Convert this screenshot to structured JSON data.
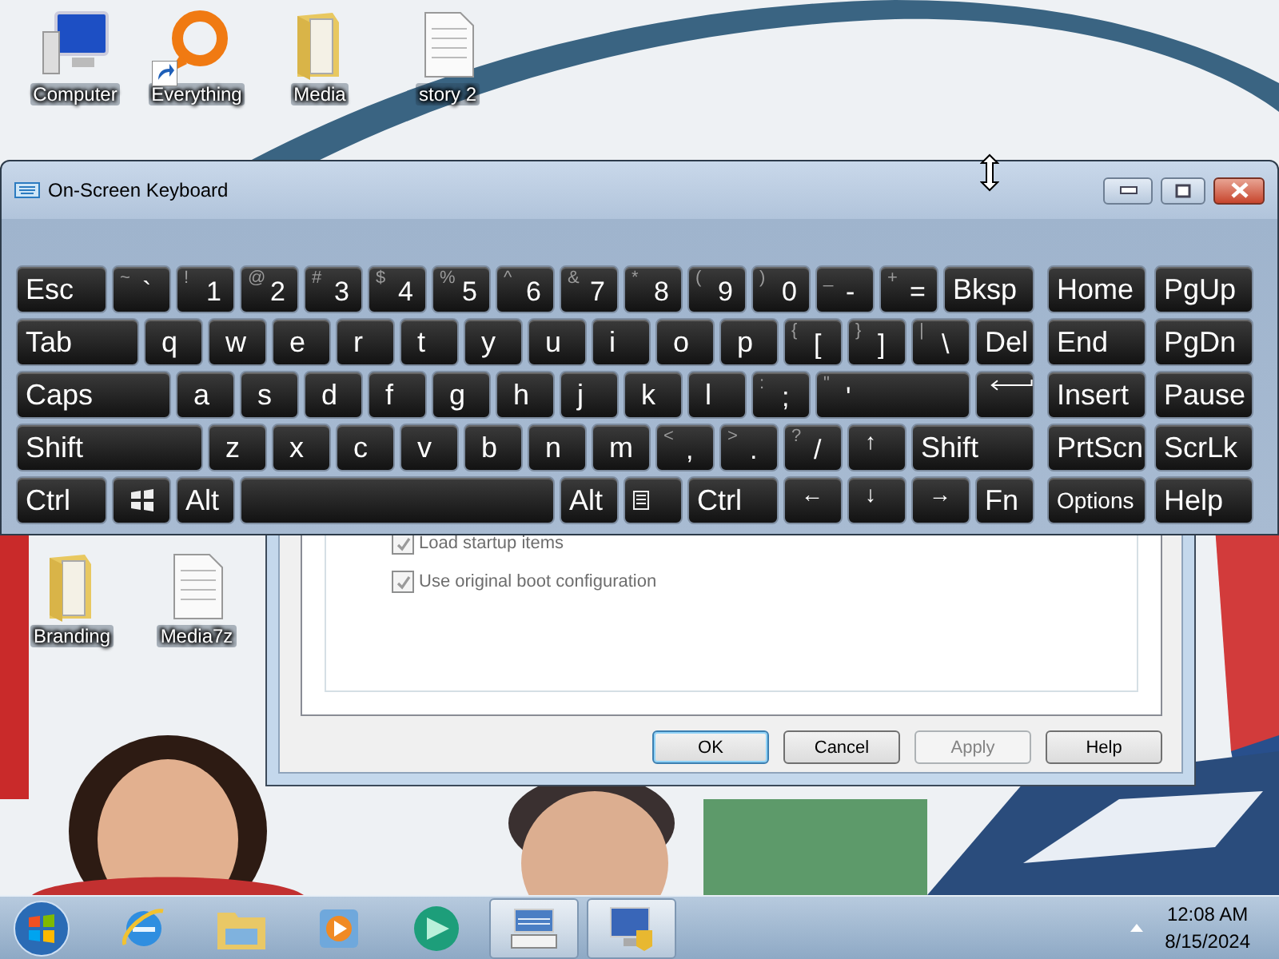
{
  "desktop_icons": [
    {
      "label": "Computer",
      "kind": "computer",
      "shortcut": false
    },
    {
      "label": "Everything",
      "kind": "everything",
      "shortcut": true
    },
    {
      "label": "Media",
      "kind": "folder",
      "shortcut": false
    },
    {
      "label": "story 2",
      "kind": "document",
      "shortcut": false
    },
    {
      "label": "Branding",
      "kind": "folder",
      "shortcut": false
    },
    {
      "label": "Media7z",
      "kind": "document",
      "shortcut": false
    }
  ],
  "background_window": {
    "checkboxes": [
      {
        "label": "Load startup items",
        "checked": true,
        "disabled": true
      },
      {
        "label": "Use original boot configuration",
        "checked": true,
        "disabled": true
      }
    ],
    "buttons": [
      {
        "label": "OK",
        "default": true,
        "disabled": false
      },
      {
        "label": "Cancel",
        "default": false,
        "disabled": false
      },
      {
        "label": "Apply",
        "default": false,
        "disabled": true
      },
      {
        "label": "Help",
        "default": false,
        "disabled": false
      }
    ]
  },
  "keyboard": {
    "title": "On-Screen Keyboard",
    "rows": [
      {
        "keys": [
          {
            "kind": "mod",
            "label": "Esc"
          },
          {
            "kind": "char",
            "label": "`",
            "shift": "~"
          },
          {
            "kind": "char",
            "label": "1",
            "shift": "!"
          },
          {
            "kind": "char",
            "label": "2",
            "shift": "@"
          },
          {
            "kind": "char",
            "label": "3",
            "shift": "#"
          },
          {
            "kind": "char",
            "label": "4",
            "shift": "$"
          },
          {
            "kind": "char",
            "label": "5",
            "shift": "%"
          },
          {
            "kind": "char",
            "label": "6",
            "shift": "^"
          },
          {
            "kind": "char",
            "label": "7",
            "shift": "&"
          },
          {
            "kind": "char",
            "label": "8",
            "shift": "*"
          },
          {
            "kind": "char",
            "label": "9",
            "shift": "("
          },
          {
            "kind": "char",
            "label": "0",
            "shift": ")"
          },
          {
            "kind": "char",
            "label": "-",
            "shift": "_"
          },
          {
            "kind": "char",
            "label": "=",
            "shift": "+"
          },
          {
            "kind": "mod",
            "label": "Bksp"
          }
        ]
      },
      {
        "keys": [
          {
            "kind": "mod",
            "label": "Tab"
          },
          {
            "kind": "char",
            "label": "q"
          },
          {
            "kind": "char",
            "label": "w"
          },
          {
            "kind": "char",
            "label": "e"
          },
          {
            "kind": "char",
            "label": "r"
          },
          {
            "kind": "char",
            "label": "t"
          },
          {
            "kind": "char",
            "label": "y"
          },
          {
            "kind": "char",
            "label": "u"
          },
          {
            "kind": "char",
            "label": "i"
          },
          {
            "kind": "char",
            "label": "o"
          },
          {
            "kind": "char",
            "label": "p"
          },
          {
            "kind": "char",
            "label": "[",
            "shift": "{"
          },
          {
            "kind": "char",
            "label": "]",
            "shift": "}"
          },
          {
            "kind": "char",
            "label": "\\",
            "shift": "|"
          },
          {
            "kind": "mod",
            "label": "Del"
          }
        ]
      },
      {
        "keys": [
          {
            "kind": "mod",
            "label": "Caps"
          },
          {
            "kind": "char",
            "label": "a"
          },
          {
            "kind": "char",
            "label": "s"
          },
          {
            "kind": "char",
            "label": "d"
          },
          {
            "kind": "char",
            "label": "f"
          },
          {
            "kind": "char",
            "label": "g"
          },
          {
            "kind": "char",
            "label": "h"
          },
          {
            "kind": "char",
            "label": "j"
          },
          {
            "kind": "char",
            "label": "k"
          },
          {
            "kind": "char",
            "label": "l"
          },
          {
            "kind": "char",
            "label": ";",
            "shift": ":"
          },
          {
            "kind": "char",
            "label": "'",
            "shift": "\""
          },
          {
            "kind": "enter"
          }
        ]
      },
      {
        "keys": [
          {
            "kind": "mod",
            "label": "Shift"
          },
          {
            "kind": "char",
            "label": "z"
          },
          {
            "kind": "char",
            "label": "x"
          },
          {
            "kind": "char",
            "label": "c"
          },
          {
            "kind": "char",
            "label": "v"
          },
          {
            "kind": "char",
            "label": "b"
          },
          {
            "kind": "char",
            "label": "n"
          },
          {
            "kind": "char",
            "label": "m"
          },
          {
            "kind": "char",
            "label": ",",
            "shift": "<"
          },
          {
            "kind": "char",
            "label": ".",
            "shift": ">"
          },
          {
            "kind": "char",
            "label": "/",
            "shift": "?"
          },
          {
            "kind": "arrow",
            "label": "↑"
          },
          {
            "kind": "mod",
            "label": "Shift"
          }
        ]
      },
      {
        "keys": [
          {
            "kind": "mod",
            "label": "Ctrl"
          },
          {
            "kind": "win"
          },
          {
            "kind": "mod",
            "label": "Alt"
          },
          {
            "kind": "space"
          },
          {
            "kind": "mod",
            "label": "Alt"
          },
          {
            "kind": "menu"
          },
          {
            "kind": "mod",
            "label": "Ctrl"
          },
          {
            "kind": "arrow",
            "label": "←"
          },
          {
            "kind": "arrow",
            "label": "↓"
          },
          {
            "kind": "arrow",
            "label": "→"
          },
          {
            "kind": "mod",
            "label": "Fn"
          }
        ]
      }
    ],
    "nav_rows": [
      {
        "keys": [
          {
            "kind": "mod",
            "label": "Home"
          },
          {
            "kind": "mod",
            "label": "PgUp"
          }
        ]
      },
      {
        "keys": [
          {
            "kind": "mod",
            "label": "End"
          },
          {
            "kind": "mod",
            "label": "PgDn"
          }
        ]
      },
      {
        "keys": [
          {
            "kind": "mod",
            "label": "Insert"
          },
          {
            "kind": "mod",
            "label": "Pause"
          }
        ]
      },
      {
        "keys": [
          {
            "kind": "mod",
            "label": "PrtScn"
          },
          {
            "kind": "mod",
            "label": "ScrLk"
          }
        ]
      },
      {
        "keys": [
          {
            "kind": "small",
            "label": "Options"
          },
          {
            "kind": "mod",
            "label": "Help"
          }
        ]
      }
    ]
  },
  "taskbar": {
    "items": [
      {
        "kind": "ie",
        "active": false
      },
      {
        "kind": "explorer",
        "active": false
      },
      {
        "kind": "player",
        "active": false
      },
      {
        "kind": "green",
        "active": false
      },
      {
        "kind": "keyboard",
        "active": true
      },
      {
        "kind": "monitor",
        "active": true
      }
    ],
    "clock": {
      "time": "12:08 AM",
      "date": "8/15/2024"
    }
  }
}
